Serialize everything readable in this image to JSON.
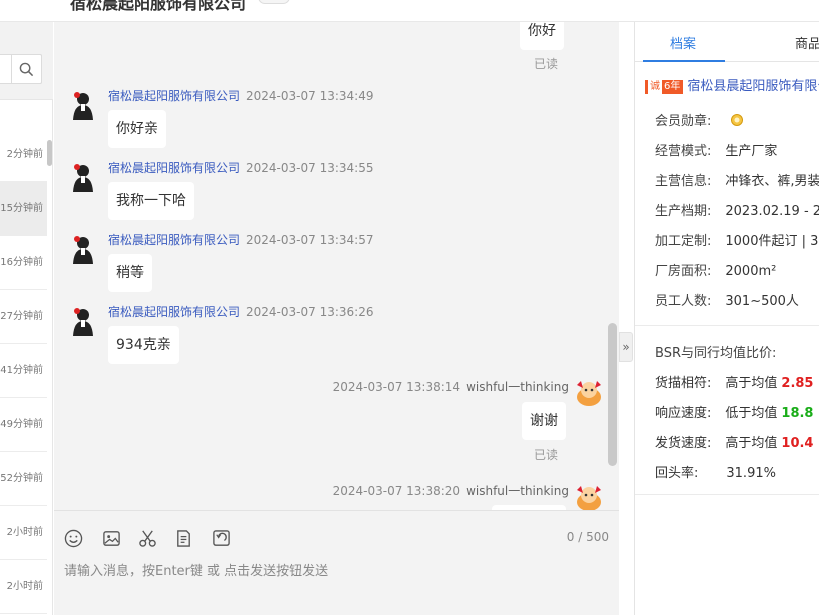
{
  "header": {
    "company": "宿松晨起阳服饰有限公司"
  },
  "conversation_list": [
    {
      "time": "2分钟前",
      "active": false
    },
    {
      "time": "15分钟前",
      "active": true
    },
    {
      "time": "16分钟前",
      "active": false
    },
    {
      "time": "27分钟前",
      "active": false
    },
    {
      "time": "41分钟前",
      "active": false
    },
    {
      "time": "49分钟前",
      "active": false
    },
    {
      "time": "52分钟前",
      "active": false
    },
    {
      "time": "2小时前",
      "active": false
    },
    {
      "time": "2小时前",
      "active": false
    }
  ],
  "chat": {
    "top_message": {
      "text": "你好",
      "status": "已读"
    },
    "messages": [
      {
        "sender": "宿松晨起阳服饰有限公司",
        "time": "2024-03-07 13:34:49",
        "text": "你好亲"
      },
      {
        "sender": "宿松晨起阳服饰有限公司",
        "time": "2024-03-07 13:34:55",
        "text": "我称一下哈"
      },
      {
        "sender": "宿松晨起阳服饰有限公司",
        "time": "2024-03-07 13:34:57",
        "text": "稍等"
      },
      {
        "sender": "宿松晨起阳服饰有限公司",
        "time": "2024-03-07 13:36:26",
        "text": "934克亲"
      }
    ],
    "self_messages": [
      {
        "time": "2024-03-07 13:38:14",
        "name": "wishful一thinking",
        "text": "谢谢",
        "status": "已读"
      },
      {
        "time": "2024-03-07 13:38:20",
        "name": "wishful一thinking"
      }
    ]
  },
  "input": {
    "counter": "0 / 500",
    "placeholder": "请输入消息，按Enter键 或 点击发送按钮发送"
  },
  "toolbar_icons": [
    "emoji-icon",
    "image-icon",
    "scissors-icon",
    "order-icon",
    "recall-icon"
  ],
  "right_panel": {
    "tabs": [
      {
        "label": "档案",
        "active": true
      },
      {
        "label": "商品",
        "active": false
      }
    ],
    "shop": {
      "years": "6年",
      "name": "宿松县晨起阳服饰有限公司"
    },
    "info": [
      {
        "label": "会员勋章:",
        "value": ""
      },
      {
        "label": "经营模式:",
        "value": "生产厂家"
      },
      {
        "label": "主营信息:",
        "value": "冲锋衣、裤,男装"
      },
      {
        "label": "生产档期:",
        "value": "2023.02.19 - 2"
      },
      {
        "label": "加工定制:",
        "value": "1000件起订 | 3"
      },
      {
        "label": "厂房面积:",
        "value": "2000m²"
      },
      {
        "label": "员工人数:",
        "value": "301~500人"
      }
    ],
    "bsr_title": "BSR与同行均值比价:",
    "bsr": [
      {
        "label": "货描相符:",
        "prefix": "高于均值",
        "value": "2.85",
        "color": "#e02020"
      },
      {
        "label": "响应速度:",
        "prefix": "低于均值",
        "value": "18.8",
        "color": "#1aad19"
      },
      {
        "label": "发货速度:",
        "prefix": "高于均值",
        "value": "10.4",
        "color": "#e02020"
      },
      {
        "label": "回头率:",
        "prefix": "31.91%",
        "value": "",
        "color": "#333333"
      }
    ]
  },
  "colors": {
    "accent": "#2f7de1",
    "sender": "#3a5bbf",
    "up": "#e02020",
    "down": "#1aad19"
  }
}
